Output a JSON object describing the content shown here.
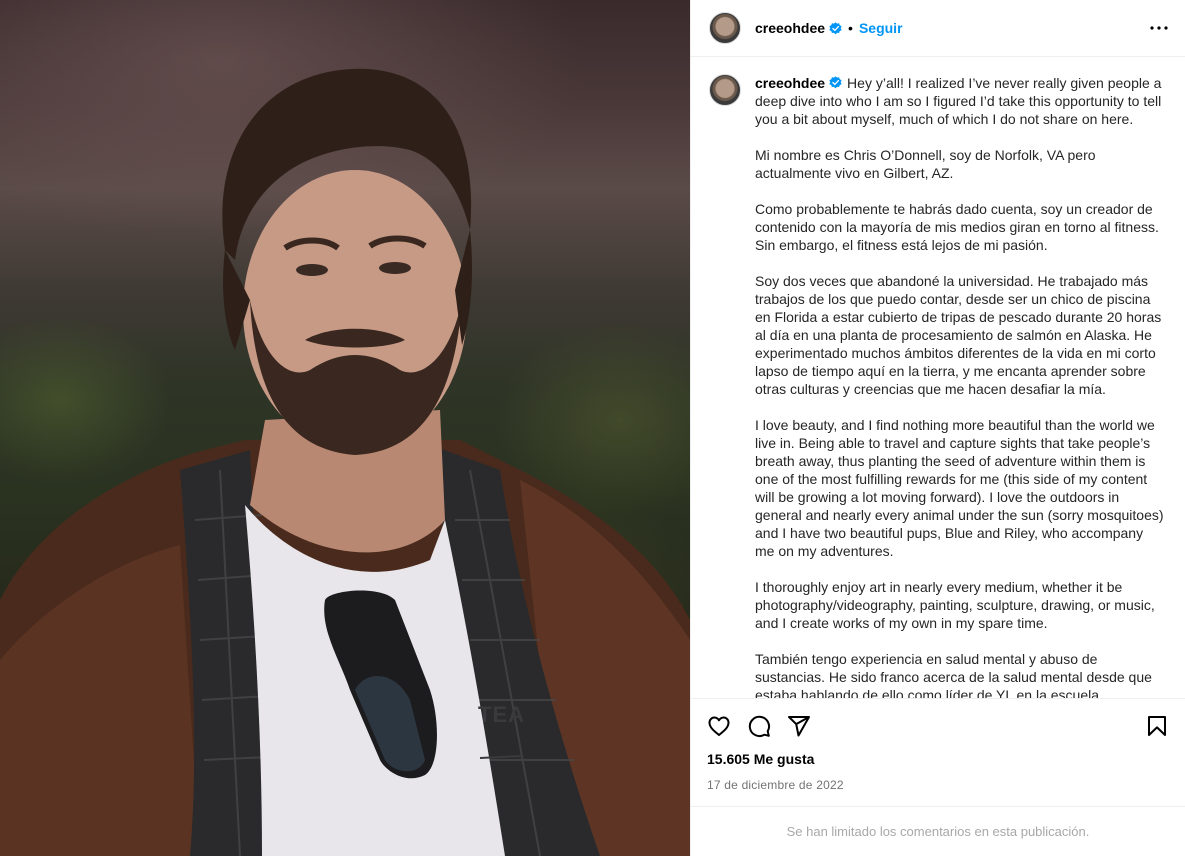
{
  "post": {
    "username": "creeohdee",
    "follow_label": "Seguir",
    "separator": "•",
    "more_label": "•••"
  },
  "caption": {
    "username": "creeohdee",
    "paragraphs": [
      "Hey y’all! I realized I’ve never really given people a deep dive into who I am so I figured I’d take this opportunity to tell you a bit about myself, much of which I do not share on here.",
      "Mi nombre es Chris O’Donnell, soy de Norfolk, VA pero actualmente vivo en Gilbert, AZ.",
      "Como probablemente te habrás dado cuenta, soy un creador de contenido con la mayoría de mis medios giran en torno al fitness. Sin embargo, el fitness está lejos de mi pasión.",
      "Soy dos veces que abandoné la universidad. He trabajado más trabajos de los que puedo contar, desde ser un chico de piscina en Florida a estar cubierto de tripas de pescado durante 20 horas al día en una planta de procesamiento de salmón en Alaska. He experimentado muchos ámbitos diferentes de la vida en mi corto lapso de tiempo aquí en la tierra, y me encanta aprender sobre otras culturas y creencias que me hacen desafiar la mía.",
      "I love beauty, and I find nothing more beautiful than the world we live in. Being able to travel and capture sights that take people’s breath away, thus planting the seed of adventure within them is one of the most fulfilling rewards for me (this side of my content will be growing a lot moving forward). I love the outdoors in general and nearly every animal under the sun (sorry mosquitoes) and I have two beautiful pups, Blue and Riley, who accompany me on my adventures.",
      "I thoroughly enjoy art in nearly every medium, whether it be photography/videography, painting, sculpture, drawing, or music, and I create works of my own in my spare time.",
      "También tengo experiencia en salud mental y abuso de sustancias. He sido franco acerca de la salud mental desde que estaba hablando de ello como líder de YL en la escuela"
    ]
  },
  "stats": {
    "likes": "15.605 Me gusta",
    "date": "17 de diciembre de 2022"
  },
  "footer": {
    "comments_limited": "Se han limitado los comentarios en esta publicación."
  },
  "colors": {
    "link_blue": "#0095f6",
    "verified_blue": "#0095f6",
    "muted": "#737373"
  },
  "icons": [
    "more-options-icon",
    "verified-badge-icon",
    "heart-icon",
    "comment-icon",
    "share-icon",
    "bookmark-icon"
  ]
}
